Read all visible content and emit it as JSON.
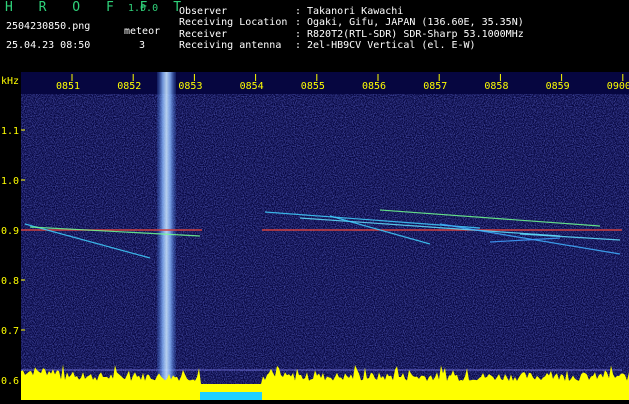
{
  "header": {
    "app_name": "H R O F F T",
    "version": "1.0.0",
    "filename": "2504230850.png",
    "datetime": "25.04.23 08:50",
    "meteor_label": "meteor",
    "meteor_count": "3",
    "info": [
      {
        "label": "Observer",
        "sep": ":",
        "value": "Takanori Kawachi"
      },
      {
        "label": "Receiving Location",
        "sep": ":",
        "value": "Ogaki, Gifu, JAPAN (136.60E, 35.35N)"
      },
      {
        "label": "Receiver",
        "sep": ":",
        "value": "R820T2(RTL-SDR) SDR-Sharp 53.1000MHz"
      },
      {
        "label": "Receiving antenna",
        "sep": ":",
        "value": "2el-HB9CV Vertical (el. E-W)"
      }
    ]
  },
  "chart_data": {
    "type": "heatmap",
    "ylabel": "kHz",
    "y_ticks": [
      "1.1",
      "1.0",
      "0.9",
      "0.8",
      "0.7",
      "0.6"
    ],
    "x_ticks": [
      "0851",
      "0852",
      "0853",
      "0854",
      "0855",
      "0856",
      "0857",
      "0858",
      "0859",
      "0900"
    ],
    "ylim": [
      0.6,
      1.2
    ],
    "colors": {
      "background": "#0a0a5c",
      "carrier": "#d04040",
      "tick_labels": "#ffff00",
      "histogram": "#ffff00",
      "gap_marker": "#20d0ff",
      "grid": "#8888ff"
    }
  }
}
